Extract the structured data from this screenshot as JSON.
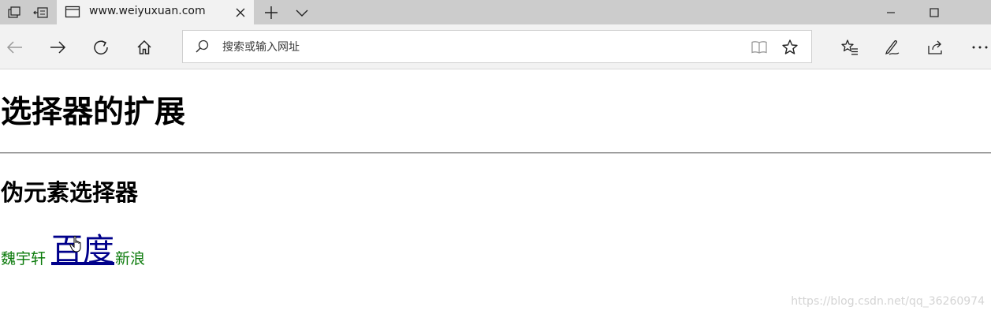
{
  "browser": {
    "tab": {
      "title": "www.weiyuxuan.com"
    },
    "address_bar": {
      "placeholder": "搜索或输入网址",
      "value": ""
    },
    "icons": {
      "tab_actions": "tab-actions-icon",
      "set_aside_tabs": "set-aside-tabs-icon",
      "favicon": "page-favicon-icon",
      "close_tab": "close-icon",
      "new_tab": "plus-icon",
      "tab_preview": "chevron-down-icon",
      "minimize": "minimize-icon",
      "maximize": "maximize-icon",
      "back": "back-arrow-icon",
      "forward": "forward-arrow-icon",
      "refresh": "refresh-icon",
      "home": "home-icon",
      "search": "search-icon",
      "reading_view": "book-icon",
      "favorite": "star-icon",
      "favorites_hub": "favorites-list-icon",
      "web_note": "pen-icon",
      "share": "share-icon",
      "more": "more-dots-icon"
    }
  },
  "page": {
    "heading": "选择器的扩展",
    "subheading": "伪元素选择器",
    "links": [
      {
        "text": "魏宇轩"
      },
      {
        "text": "百度"
      },
      {
        "text": "新浪"
      }
    ],
    "watermark": "https://blog.csdn.net/qq_36260974"
  },
  "colors": {
    "chrome_bg": "#cccccc",
    "toolbar_bg": "#f2f2f2",
    "link_green": "#0a7a0a",
    "link_hover": "#00008b"
  }
}
